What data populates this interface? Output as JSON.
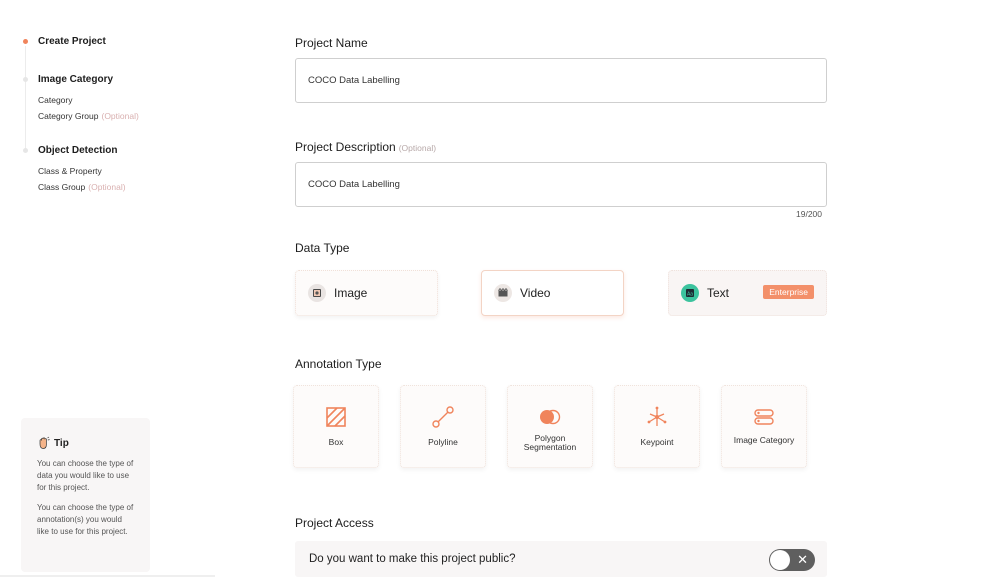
{
  "sidebar": {
    "steps": [
      {
        "title": "Create Project",
        "subitems": []
      },
      {
        "title": "Image Category",
        "subitems": [
          {
            "label": "Category",
            "optional": ""
          },
          {
            "label": "Category Group",
            "optional": "(Optional)"
          }
        ]
      },
      {
        "title": "Object Detection",
        "subitems": [
          {
            "label": "Class & Property",
            "optional": ""
          },
          {
            "label": "Class Group",
            "optional": "(Optional)"
          }
        ]
      }
    ],
    "tip": {
      "title": "Tip",
      "p1": "You can choose the type of data you would like to use for this project.",
      "p2": "You can choose the type of annotation(s) you would like to use for this project."
    }
  },
  "form": {
    "project_name": {
      "label": "Project Name",
      "value": "COCO Data Labelling"
    },
    "project_description": {
      "label": "Project Description",
      "optional": "(Optional)",
      "value": "COCO Data Labelling",
      "counter": "19/200"
    },
    "data_type": {
      "label": "Data Type",
      "options": [
        {
          "label": "Image",
          "icon": "image-icon"
        },
        {
          "label": "Video",
          "icon": "video-icon"
        },
        {
          "label": "Text",
          "icon": "text-icon",
          "badge": "Enterprise"
        }
      ]
    },
    "annotation_type": {
      "label": "Annotation Type",
      "options": [
        {
          "label": "Box",
          "icon": "box-icon"
        },
        {
          "label": "Polyline",
          "icon": "polyline-icon"
        },
        {
          "label": "Polygon Segmentation",
          "icon": "polygon-segmentation-icon"
        },
        {
          "label": "Keypoint",
          "icon": "keypoint-icon"
        },
        {
          "label": "Image Category",
          "icon": "image-category-icon"
        }
      ]
    },
    "project_access": {
      "label": "Project Access",
      "question": "Do you want to make this project public?"
    }
  },
  "colors": {
    "accent": "#f0845c",
    "badge": "#f3906a",
    "toggle_off": "#5f5f5f"
  }
}
